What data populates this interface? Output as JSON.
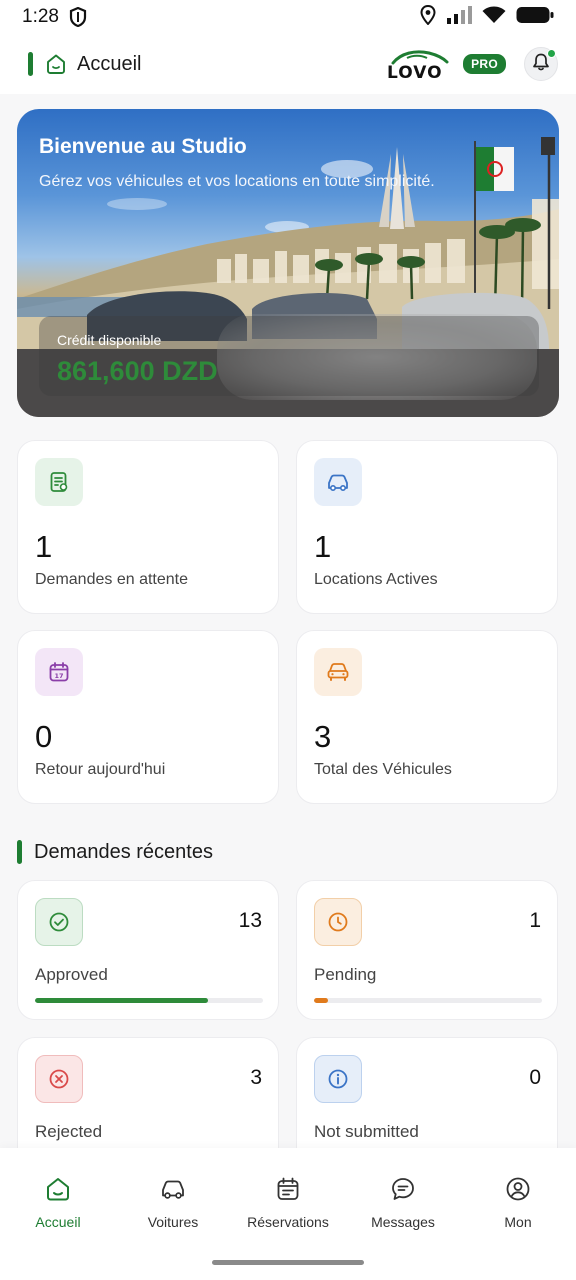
{
  "status_bar": {
    "time": "1:28"
  },
  "header": {
    "title": "Accueil",
    "logo_text": "LOVO",
    "badge": "PRO"
  },
  "hero": {
    "title": "Bienvenue au Studio",
    "subtitle": "Gérez vos véhicules et vos locations en toute simplicité.",
    "credit_label": "Crédit disponible",
    "credit_value": "861,600 DZD"
  },
  "stats": [
    {
      "value": "1",
      "label": "Demandes en attente",
      "icon": "document-icon",
      "color": "#2e8b3a"
    },
    {
      "value": "1",
      "label": "Locations Actives",
      "icon": "car-icon",
      "color": "#3b74c6"
    },
    {
      "value": "0",
      "label": "Retour aujourd'hui",
      "icon": "calendar-icon",
      "color": "#8a3ea8"
    },
    {
      "value": "3",
      "label": "Total des Véhicules",
      "icon": "car-front-icon",
      "color": "#e07a1c"
    }
  ],
  "recent": {
    "title": "Demandes récentes",
    "items": [
      {
        "label": "Approved",
        "count": "13",
        "icon": "check-circle-icon",
        "color": "#2e8b3a",
        "progress": 0.76
      },
      {
        "label": "Pending",
        "count": "1",
        "icon": "clock-icon",
        "color": "#e07a1c",
        "progress": 0.06
      },
      {
        "label": "Rejected",
        "count": "3",
        "icon": "x-circle-icon",
        "color": "#d94a4a"
      },
      {
        "label": "Not submitted",
        "count": "0",
        "icon": "info-circle-icon",
        "color": "#3b74c6"
      }
    ]
  },
  "bottom_nav": [
    {
      "label": "Accueil",
      "icon": "home-icon",
      "active": true
    },
    {
      "label": "Voitures",
      "icon": "car-icon",
      "active": false
    },
    {
      "label": "Réservations",
      "icon": "calendar-list-icon",
      "active": false
    },
    {
      "label": "Messages",
      "icon": "chat-icon",
      "active": false
    },
    {
      "label": "Mon",
      "icon": "profile-icon",
      "active": false
    }
  ],
  "colors": {
    "brand_green": "#1e7d32",
    "accent_green": "#2e8b3a"
  }
}
